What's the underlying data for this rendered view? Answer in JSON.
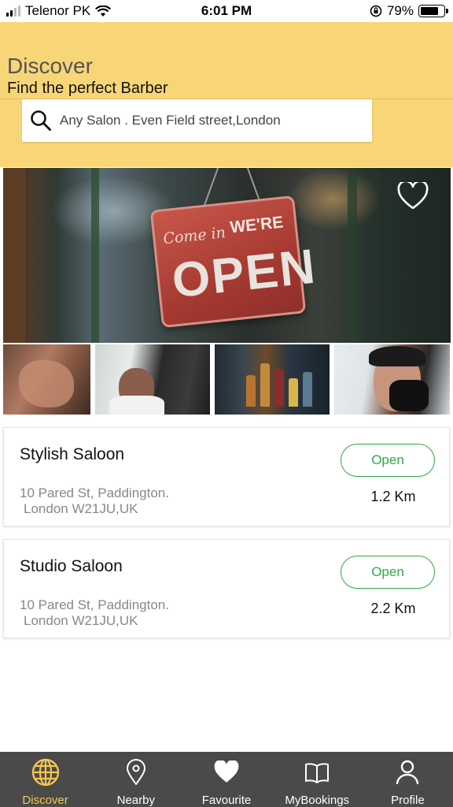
{
  "status_bar": {
    "carrier": "Telenor PK",
    "time": "6:01 PM",
    "battery": "79%"
  },
  "header": {
    "title": "Discover",
    "subtitle": "Find the perfect Barber",
    "background": "#f8d576"
  },
  "search": {
    "placeholder": "Any Salon . Even Field street,London",
    "icon": "search-icon"
  },
  "hero": {
    "sign_script": "Come in",
    "sign_top": "WE'RE",
    "sign_big": "OPEN",
    "favourite_icon": "heart-outline-icon"
  },
  "salons": [
    {
      "name": "Stylish Saloon",
      "address_line1": "10 Pared St, Paddington.",
      "address_line2": "London W21JU,UK",
      "status": "Open",
      "distance": "1.2 Km"
    },
    {
      "name": "Studio Saloon",
      "address_line1": "10 Pared St, Paddington.",
      "address_line2": "London W21JU,UK",
      "status": "Open",
      "distance": "2.2 Km"
    }
  ],
  "bottom_nav": {
    "items": [
      {
        "label": "Discover",
        "icon": "globe-icon",
        "active": true
      },
      {
        "label": "Nearby",
        "icon": "location-pin-icon",
        "active": false
      },
      {
        "label": "Favourite",
        "icon": "heart-icon",
        "active": false
      },
      {
        "label": "MyBookings",
        "icon": "book-icon",
        "active": false
      },
      {
        "label": "Profile",
        "icon": "user-icon",
        "active": false
      }
    ],
    "active_color": "#f3c64f",
    "background": "#4a4a4a"
  },
  "colors": {
    "open_status": "#2fa84a"
  }
}
